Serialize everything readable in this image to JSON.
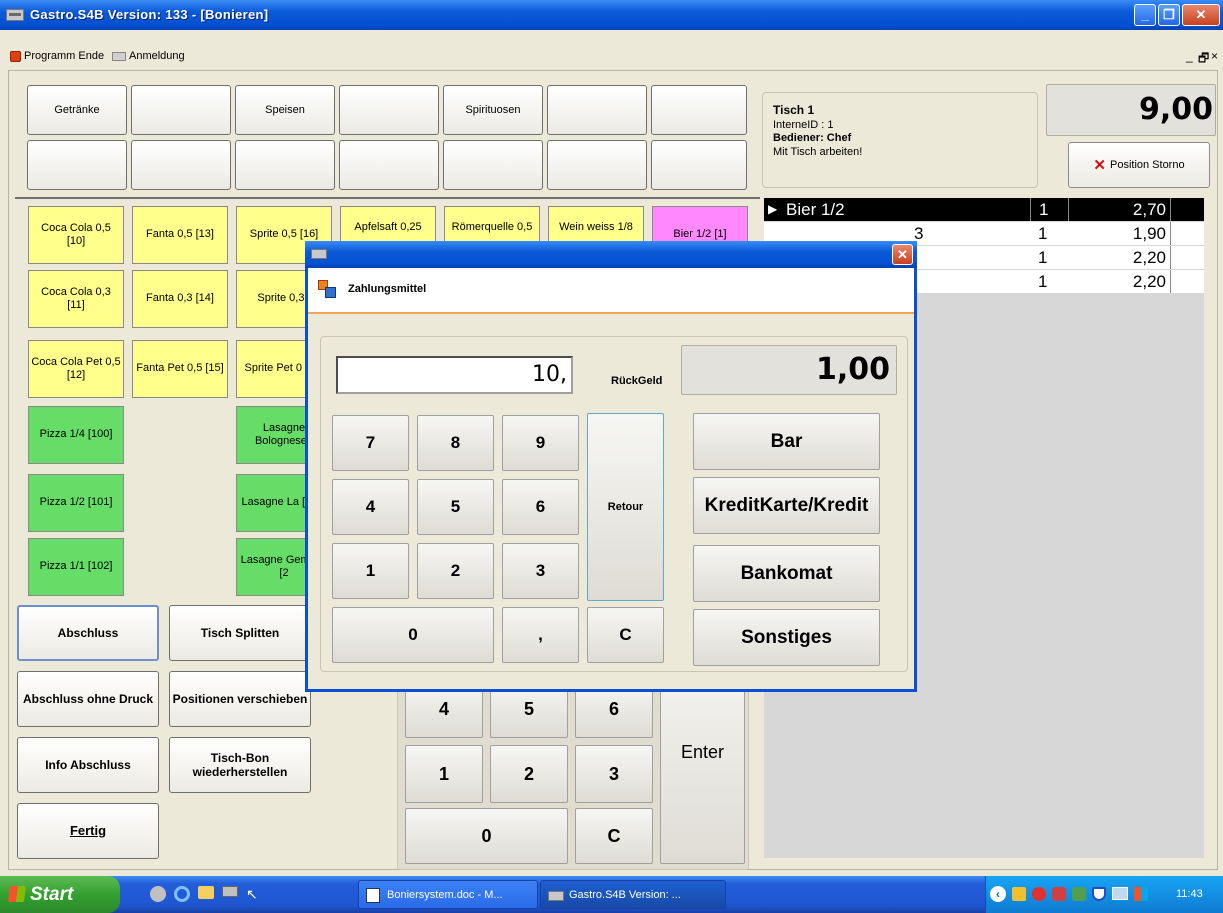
{
  "window": {
    "title": "Gastro.S4B Version:  133 - [Bonieren]"
  },
  "menu": {
    "item1": "Programm Ende",
    "item2": "Anmeldung"
  },
  "categories": [
    "Getränke",
    "",
    "Speisen",
    "",
    "Spirituosen",
    "",
    "",
    "",
    "",
    "",
    "",
    "",
    "",
    ""
  ],
  "products": {
    "coca05": "Coca Cola 0,5 [10]",
    "fanta05": "Fanta 0,5 [13]",
    "sprite05": "Sprite 0,5 [16]",
    "apfelsaft": "Apfelsaft 0,25",
    "roemerquelle": "Römerquelle 0,5",
    "wein": "Wein weiss 1/8",
    "bier": "Bier 1/2 [1]",
    "coca03": "Coca Cola 0,3 [11]",
    "fanta03": "Fanta  0,3 [14]",
    "sprite03": "Sprite 0,3 [",
    "cocapet": "Coca Cola Pet 0,5 [12]",
    "fantapet": "Fanta Pet 0,5 [15]",
    "spritepet": "Sprite Pet 0 [18]",
    "pizza14": "Pizza 1/4 [100]",
    "lasagne_bol": "Lasagne Bolognese [",
    "pizza12": "Pizza 1/2 [101]",
    "lasagne_la": "Lasagne La [201]",
    "pizza11": "Pizza 1/1 [102]",
    "lasagne_gem": "Lasagne Gemüse [2"
  },
  "actions": {
    "abschluss": "Abschluss",
    "tisch_splitten": "Tisch Splitten",
    "abschluss_ohne_druck": "Abschluss ohne Druck",
    "positionen_verschieben": "Positionen verschieben",
    "info_abschluss": "Info Abschluss",
    "tisch_bon": "Tisch-Bon wiederherstellen",
    "fertig": "Fertig"
  },
  "bg_keypad": {
    "k4": "4",
    "k5": "5",
    "k6": "6",
    "k1": "1",
    "k2": "2",
    "k3": "3",
    "k0": "0",
    "kc": "C",
    "enter": "Enter"
  },
  "info": {
    "tisch": "Tisch  1",
    "interne_id": "InterneID : 1",
    "bediener": "Bediener: Chef",
    "hinweis": "Mit Tisch arbeiten!"
  },
  "total": "9,00",
  "storno_label": "Position Storno",
  "order": [
    {
      "name": "Bier 1/2",
      "qty": "1",
      "price": "2,70",
      "selected": true
    },
    {
      "name": "3",
      "qty": "1",
      "price": "1,90"
    },
    {
      "name": "",
      "qty": "1",
      "price": "2,20"
    },
    {
      "name": "",
      "qty": "1",
      "price": "2,20"
    }
  ],
  "dialog": {
    "header": "Zahlungsmittel",
    "input_value": "10,",
    "rueckgeld_label": "RückGeld",
    "rueckgeld_value": "1,00",
    "keys": {
      "k7": "7",
      "k8": "8",
      "k9": "9",
      "k4": "4",
      "k5": "5",
      "k6": "6",
      "k1": "1",
      "k2": "2",
      "k3": "3",
      "k0": "0",
      "comma": ",",
      "c": "C"
    },
    "retour": "Retour",
    "payments": [
      "Bar",
      "KreditKarte/Kredit",
      "Bankomat",
      "Sonstiges"
    ]
  },
  "taskbar": {
    "start": "Start",
    "task1": "Boniersystem.doc - M...",
    "task2": "Gastro.S4B Version: ...",
    "clock": "11:43"
  },
  "colors": {
    "title_blue": "#0a5ad8",
    "product_yellow": "#ffff8c",
    "product_green": "#66dd66",
    "product_pink": "#ff88ff",
    "selected_row": "#000000"
  }
}
